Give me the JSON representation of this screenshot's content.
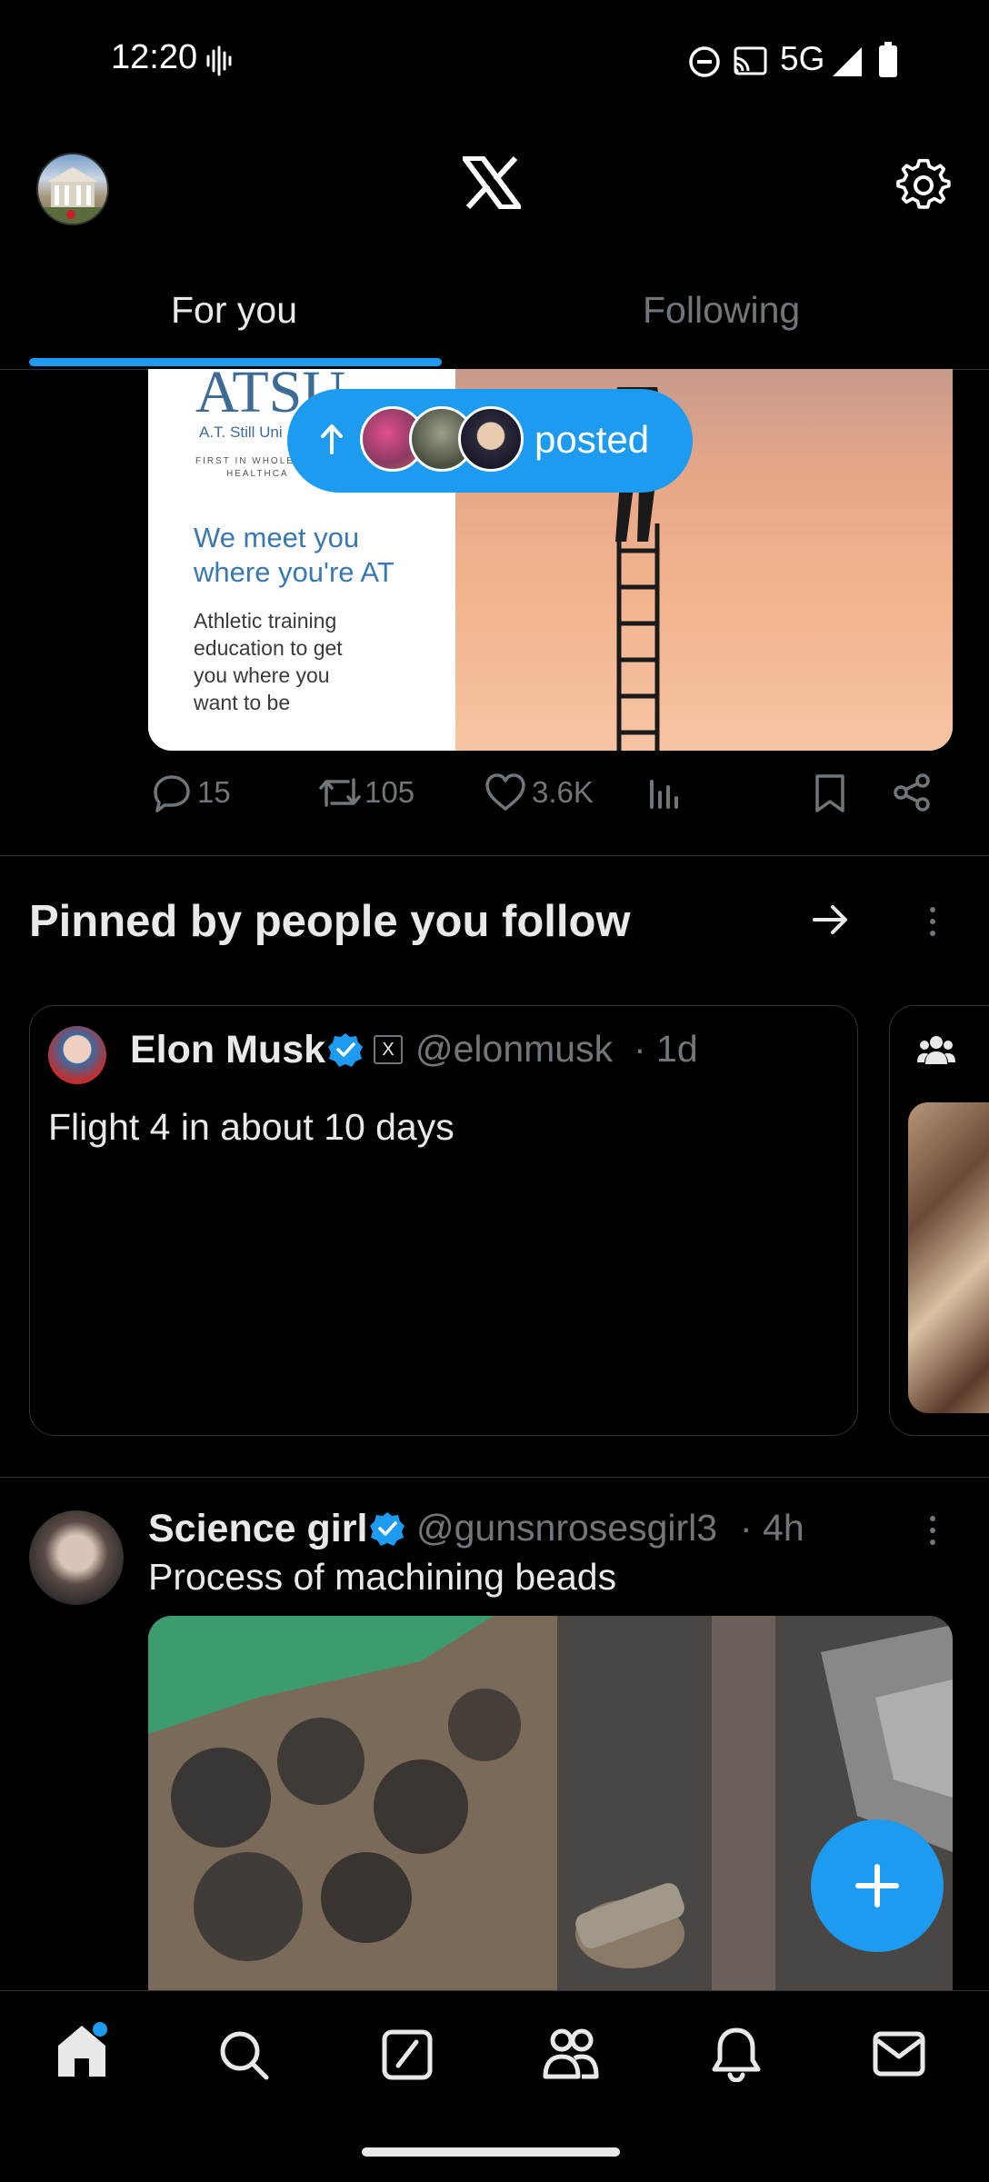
{
  "status_bar": {
    "time": "12:20",
    "network": "5G"
  },
  "header": {
    "logo": "X"
  },
  "tabs": [
    {
      "label": "For you",
      "selected": true
    },
    {
      "label": "Following",
      "selected": false
    }
  ],
  "promo_post": {
    "brand": "ATSU",
    "brand_sub": "A.T. Still Uni",
    "brand_tag1": "FIRST IN WHOLE",
    "brand_tag2": "HEALTHCA",
    "headline1": "We meet you",
    "headline2": "where you're AT",
    "body1": "Athletic training",
    "body2": "education to get",
    "body3": "you where you",
    "body4": "want to be",
    "stats": {
      "replies": "15",
      "reposts": "105",
      "likes": "3.6K"
    }
  },
  "new_posts_pill": {
    "label": "posted"
  },
  "pinned_section": {
    "title": "Pinned by people you follow",
    "card": {
      "name": "Elon Musk",
      "badge": "X",
      "handle": "@elonmusk",
      "time": "· 1d",
      "text": "Flight 4 in about 10 days"
    }
  },
  "feed_post": {
    "name": "Science girl",
    "handle": "@gunsnrosesgirl3",
    "time": "· 4h",
    "text": "Process of machining beads"
  },
  "colors": {
    "accent": "#1d9bf0",
    "background": "#000000",
    "muted": "#71767b"
  },
  "icons": [
    "settings-gear-icon",
    "x-logo-icon",
    "reply-icon",
    "repost-icon",
    "like-icon",
    "views-icon",
    "bookmark-icon",
    "share-icon",
    "arrow-right-icon",
    "more-vertical-icon",
    "verified-badge-icon",
    "home-icon",
    "search-icon",
    "grok-icon",
    "communities-icon",
    "notifications-icon",
    "messages-icon",
    "compose-plus-icon"
  ]
}
